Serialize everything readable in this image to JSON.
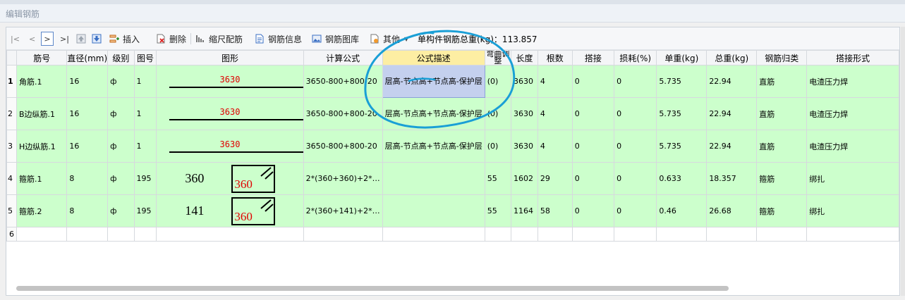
{
  "window": {
    "title": "编辑钢筋"
  },
  "toolbar": {
    "nav": [
      "|<",
      "<",
      ">",
      ">|"
    ],
    "insert_label": "插入",
    "delete_label": "删除",
    "scale_label": "缩尺配筋",
    "rebar_info_label": "钢筋信息",
    "rebar_library_label": "钢筋图库",
    "other_label": "其他",
    "weight_text": "单构件钢筋总重(kg)：113.857"
  },
  "table": {
    "columns": [
      "筋号",
      "直径(mm)",
      "级别",
      "图号",
      "图形",
      "计算公式",
      "公式描述",
      "弯曲调整",
      "长度",
      "根数",
      "搭接",
      "损耗(%)",
      "单重(kg)",
      "总重(kg)",
      "钢筋归类",
      "搭接形式"
    ],
    "rows": [
      {
        "rn": "1",
        "name": "角筋.1",
        "dia": "16",
        "grade": "ф",
        "fig": "1",
        "shape_type": "line",
        "shape_dim": "3630",
        "formula": "3650-800+800-20",
        "desc": "层高-节点高+节点高-保护层",
        "bend": "(0)",
        "length": "3630",
        "count": "4",
        "lap": "0",
        "loss": "0",
        "unit_w": "5.735",
        "total_w": "22.94",
        "category": "直筋",
        "lap_type": "电渣压力焊"
      },
      {
        "rn": "2",
        "name": "B边纵筋.1",
        "dia": "16",
        "grade": "ф",
        "fig": "1",
        "shape_type": "line",
        "shape_dim": "3630",
        "formula": "3650-800+800-20",
        "desc": "层高-节点高+节点高-保护层",
        "bend": "(0)",
        "length": "3630",
        "count": "4",
        "lap": "0",
        "loss": "0",
        "unit_w": "5.735",
        "total_w": "22.94",
        "category": "直筋",
        "lap_type": "电渣压力焊"
      },
      {
        "rn": "3",
        "name": "H边纵筋.1",
        "dia": "16",
        "grade": "ф",
        "fig": "1",
        "shape_type": "line",
        "shape_dim": "3630",
        "formula": "3650-800+800-20",
        "desc": "层高-节点高+节点高-保护层",
        "bend": "(0)",
        "length": "3630",
        "count": "4",
        "lap": "0",
        "loss": "0",
        "unit_w": "5.735",
        "total_w": "22.94",
        "category": "直筋",
        "lap_type": "电渣压力焊"
      },
      {
        "rn": "4",
        "name": "箍筋.1",
        "dia": "8",
        "grade": "ф",
        "fig": "195",
        "shape_type": "stirrup",
        "shape_left": "360",
        "shape_box": "360",
        "formula": "2*(360+360)+2*…",
        "desc": "",
        "bend": "55",
        "length": "1602",
        "count": "29",
        "lap": "0",
        "loss": "0",
        "unit_w": "0.633",
        "total_w": "18.357",
        "category": "箍筋",
        "lap_type": "绑扎"
      },
      {
        "rn": "5",
        "name": "箍筋.2",
        "dia": "8",
        "grade": "ф",
        "fig": "195",
        "shape_type": "stirrup",
        "shape_left": "141",
        "shape_box": "360",
        "formula": "2*(360+141)+2*…",
        "desc": "",
        "bend": "55",
        "length": "1164",
        "count": "58",
        "lap": "0",
        "loss": "0",
        "unit_w": "0.46",
        "total_w": "26.68",
        "category": "箍筋",
        "lap_type": "绑扎"
      }
    ],
    "empty_row_label": "6"
  },
  "colors": {
    "row_bg": "#ccffcc",
    "highlight_header": "#fdeea3",
    "selected_cell": "#c4d0ee",
    "dimension_text": "#e00000",
    "annotation": "#1a9fd6"
  }
}
